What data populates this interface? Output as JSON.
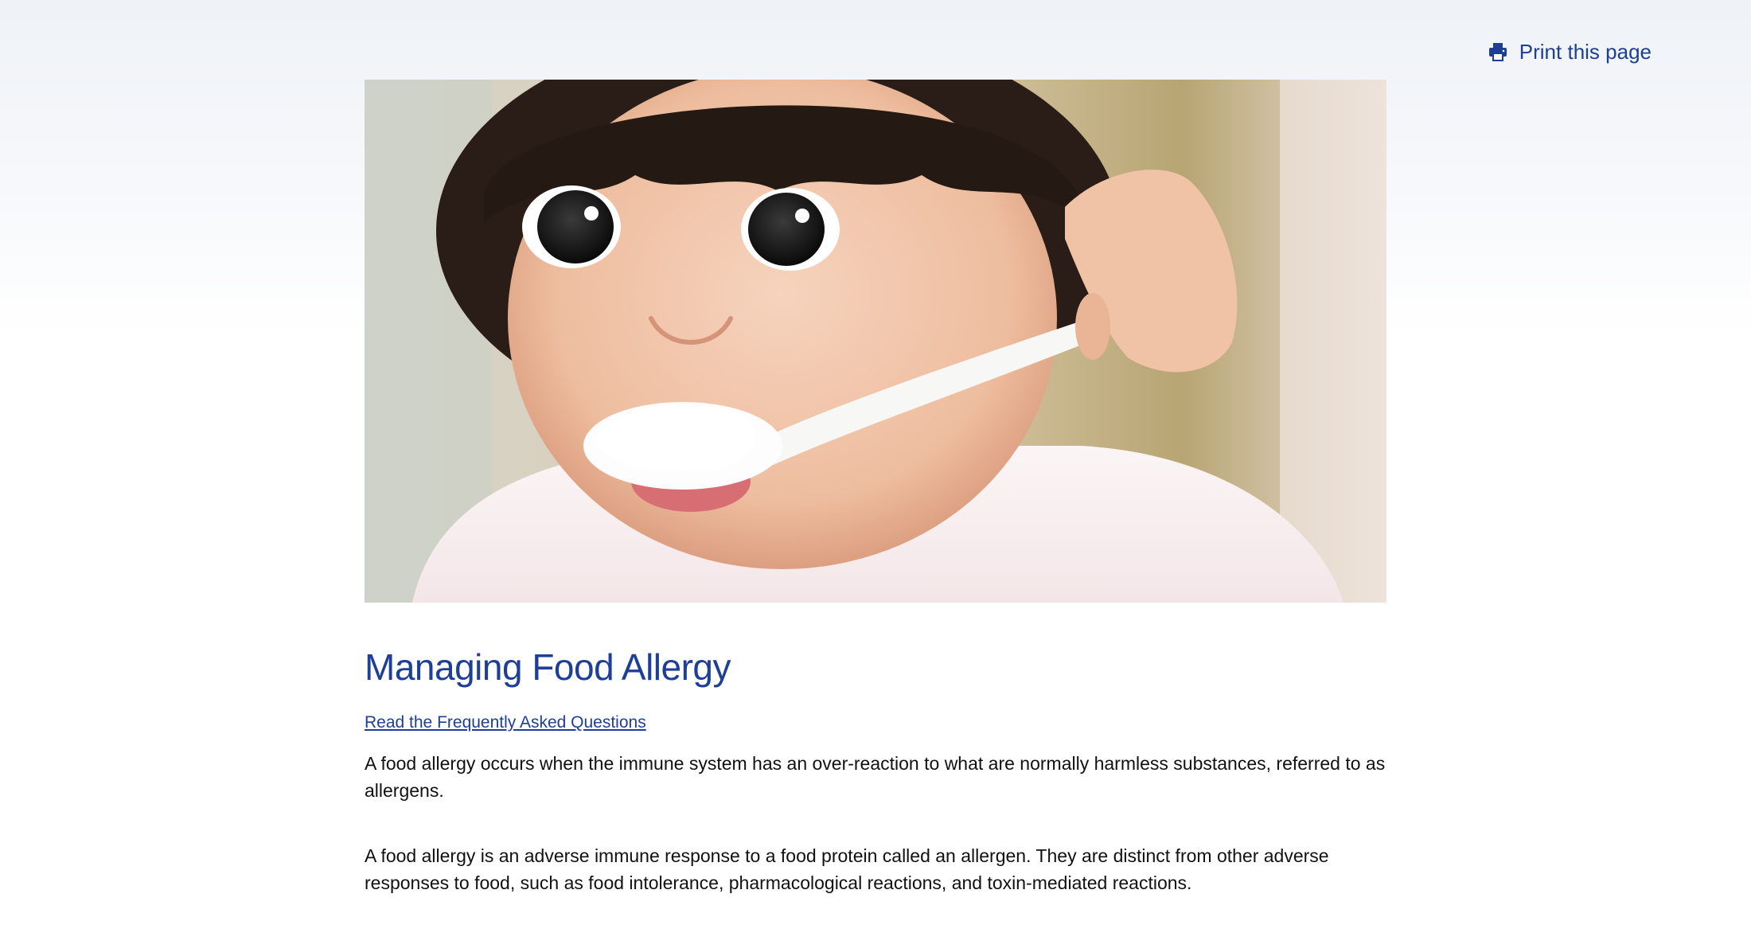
{
  "toolbar": {
    "print_label": "Print this page",
    "print_icon": "printer-icon"
  },
  "hero": {
    "image": "child-eating-from-spoon-photo"
  },
  "article": {
    "title": "Managing Food Allergy",
    "faq_link": "Read the Frequently Asked Questions",
    "paragraphs": [
      "A food allergy occurs when the immune system has an over-reaction to what are normally harmless substances, referred to as allergens.",
      "A food allergy is an adverse immune response to a food protein called an allergen. They are distinct from other adverse responses to food, such as food intolerance, pharmacological reactions, and toxin-mediated reactions."
    ]
  },
  "colors": {
    "brand_blue": "#1e3f98",
    "text": "#111111",
    "background_top": "#eff2f7",
    "background": "#ffffff"
  }
}
